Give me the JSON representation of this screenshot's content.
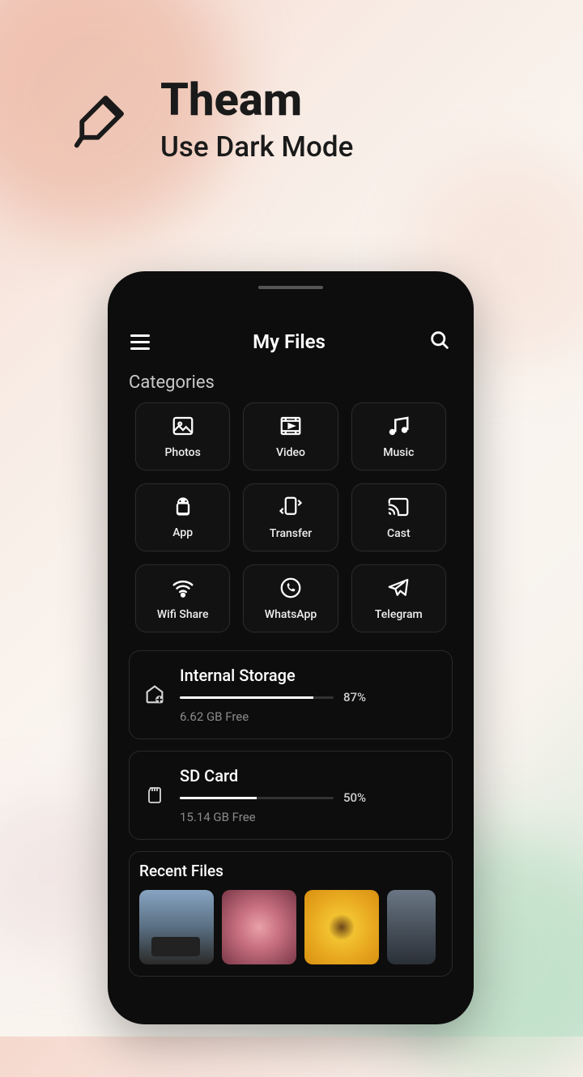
{
  "header": {
    "title": "Theam",
    "subtitle": "Use Dark Mode"
  },
  "app": {
    "title": "My Files",
    "categories_label": "Categories",
    "categories": [
      {
        "label": "Photos",
        "icon": "photos"
      },
      {
        "label": "Video",
        "icon": "video"
      },
      {
        "label": "Music",
        "icon": "music"
      },
      {
        "label": "App",
        "icon": "app"
      },
      {
        "label": "Transfer",
        "icon": "transfer"
      },
      {
        "label": "Cast",
        "icon": "cast"
      },
      {
        "label": "Wifi Share",
        "icon": "wifi"
      },
      {
        "label": "WhatsApp",
        "icon": "whatsapp"
      },
      {
        "label": "Telegram",
        "icon": "telegram"
      }
    ],
    "storage": [
      {
        "title": "Internal Storage",
        "percent_label": "87%",
        "percent": 87,
        "free": "6.62 GB Free"
      },
      {
        "title": "SD Card",
        "percent_label": "50%",
        "percent": 50,
        "free": "15.14 GB Free"
      }
    ],
    "recent_label": "Recent Files"
  }
}
